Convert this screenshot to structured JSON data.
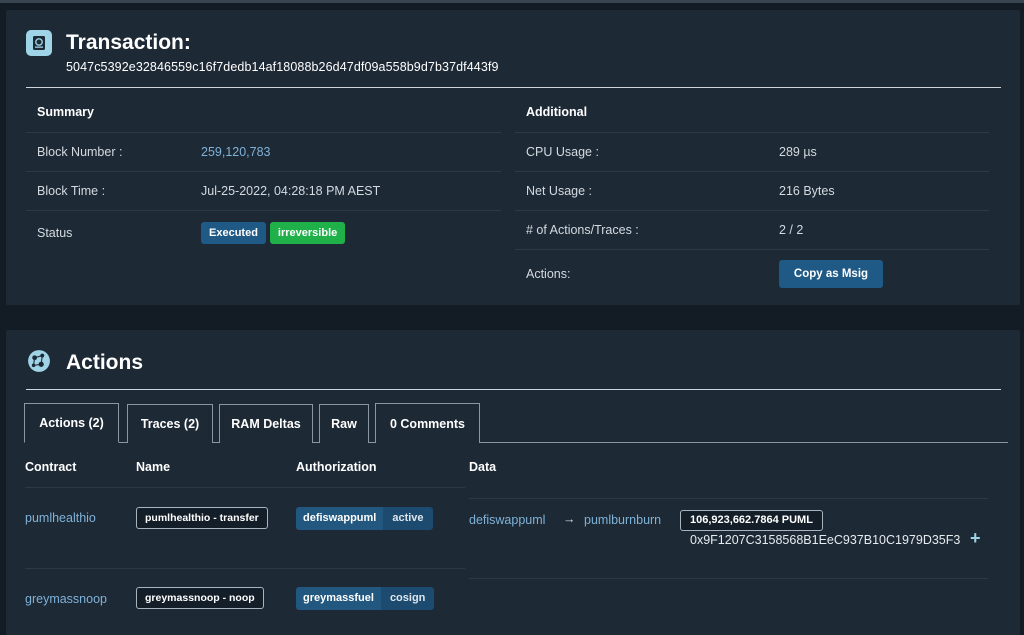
{
  "transaction": {
    "title": "Transaction:",
    "id": "5047c5392e32846559c16f7dedb14af18088b26d47df09a558b9d7b37df443f9",
    "summary": {
      "title": "Summary",
      "block_number_label": "Block Number :",
      "block_number": "259,120,783",
      "block_time_label": "Block Time :",
      "block_time": "Jul-25-2022, 04:28:18 PM AEST",
      "status_label": "Status",
      "status_executed": "Executed",
      "status_irreversible": "irreversible"
    },
    "additional": {
      "title": "Additional",
      "cpu_label": "CPU Usage :",
      "cpu_value": "289 µs",
      "net_label": "Net Usage :",
      "net_value": "216 Bytes",
      "actions_traces_label": "# of Actions/Traces :",
      "actions_traces_value": "2 / 2",
      "actions_label": "Actions:",
      "copy_msig_button": "Copy as Msig"
    }
  },
  "actions": {
    "title": "Actions",
    "tabs": [
      {
        "label": "Actions (2)",
        "active": true
      },
      {
        "label": "Traces (2)",
        "active": false
      },
      {
        "label": "RAM Deltas",
        "active": false
      },
      {
        "label": "Raw",
        "active": false
      },
      {
        "label": "0 Comments",
        "active": false
      }
    ],
    "columns": [
      "Contract",
      "Name",
      "Authorization",
      "Data"
    ],
    "rows": [
      {
        "contract": "pumlhealthio",
        "name": "pumlhealthio - transfer",
        "auth_actor": "defiswappuml",
        "auth_perm": "active",
        "from": "defiswappuml",
        "arrow": "→",
        "to": "pumlburnburn",
        "amount": "106,923,662.7864 PUML",
        "memo": "0x9F1207C3158568B1EeC937B10C1979D35F3",
        "expand": "+"
      },
      {
        "contract": "greymassnoop",
        "name": "greymassnoop - noop",
        "auth_actor": "greymassfuel",
        "auth_perm": "cosign"
      }
    ]
  },
  "icons": {
    "transaction": "receipt-icon",
    "actions": "network-globe-icon"
  },
  "colors": {
    "background": "#131c25",
    "card": "#1d2935",
    "link": "#7fb2d8",
    "badge_blue": "#1f5a86",
    "badge_green": "#20b04a"
  }
}
